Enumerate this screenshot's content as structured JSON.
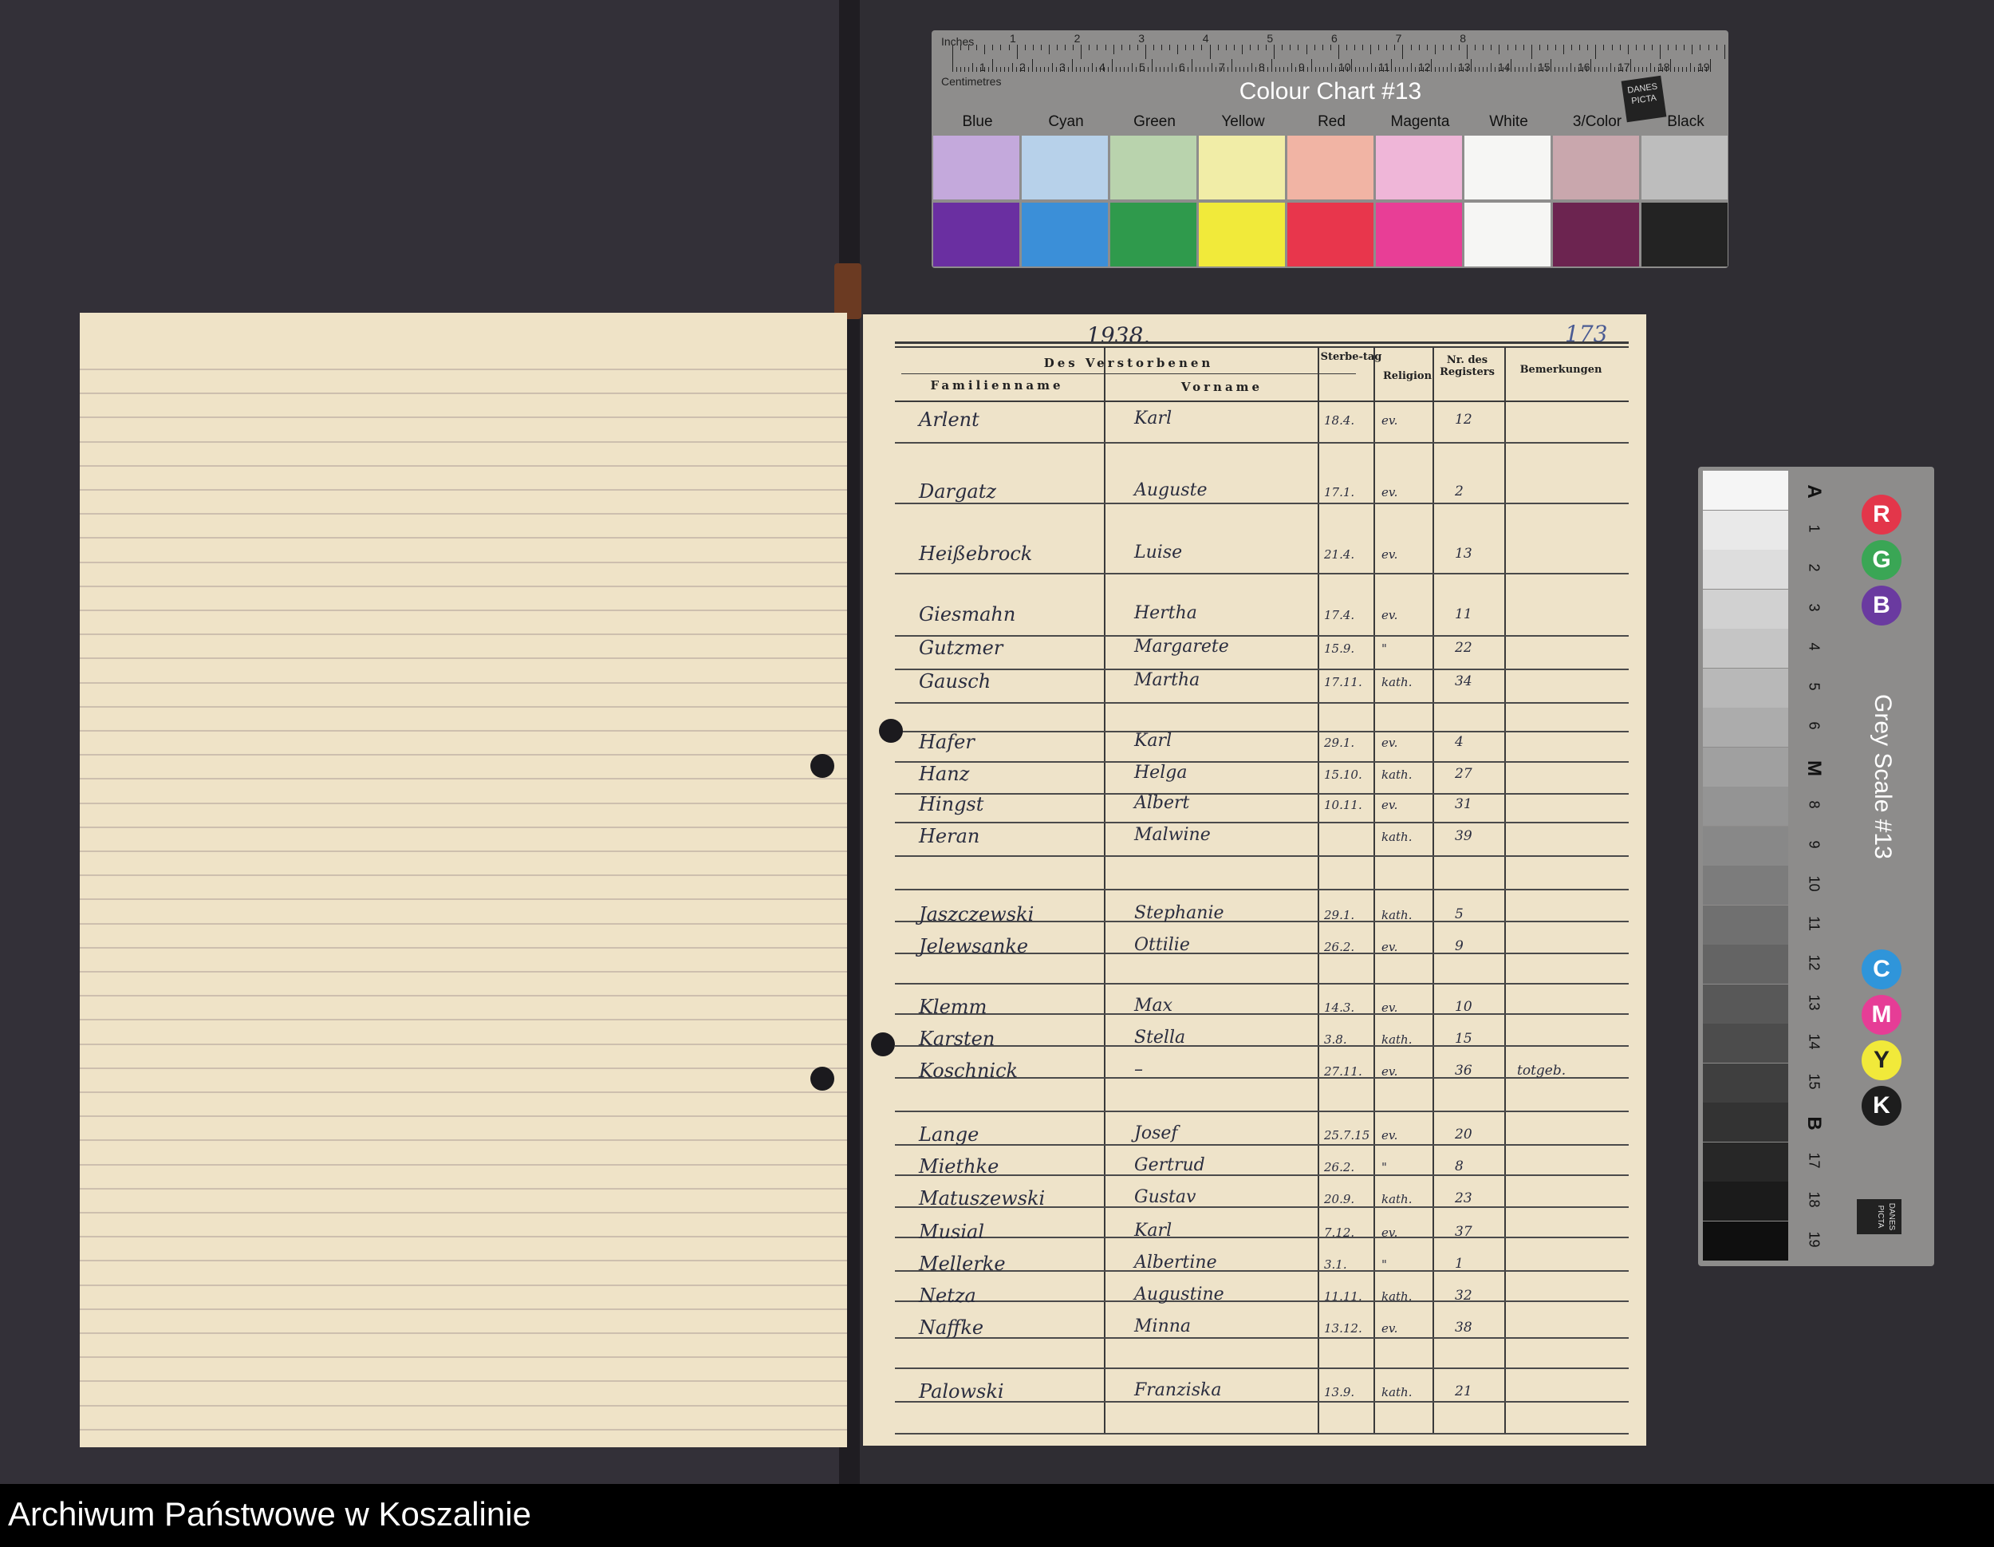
{
  "footer": {
    "archive_name": "Archiwum Państwowe w Koszalinie"
  },
  "colour_chart": {
    "ruler_inches_label": "Inches",
    "ruler_cm_label": "Centimetres",
    "inch_numbers": [
      "1",
      "2",
      "3",
      "4",
      "5",
      "6",
      "7",
      "8"
    ],
    "cm_numbers": [
      "1",
      "2",
      "3",
      "4",
      "5",
      "6",
      "7",
      "8",
      "9",
      "10",
      "11",
      "12",
      "13",
      "14",
      "15",
      "16",
      "17",
      "18",
      "19"
    ],
    "title": "Colour Chart #13",
    "brand": "DANES PICTA",
    "patches": [
      {
        "name": "Blue",
        "light": "#c4a9dc",
        "dark": "#6a2fa1"
      },
      {
        "name": "Cyan",
        "light": "#b7d1ea",
        "dark": "#3b8fd8"
      },
      {
        "name": "Green",
        "light": "#b9d3ad",
        "dark": "#2f9a4c"
      },
      {
        "name": "Yellow",
        "light": "#f1eda7",
        "dark": "#f1ea3a"
      },
      {
        "name": "Red",
        "light": "#f1b4a4",
        "dark": "#e8364c"
      },
      {
        "name": "Magenta",
        "light": "#efb6d8",
        "dark": "#e83e96"
      },
      {
        "name": "White",
        "light": "#f6f6f4",
        "dark": "#f6f6f4"
      },
      {
        "name": "3/Color",
        "light": "#c9a7ad",
        "dark": "#6c2450"
      },
      {
        "name": "Black",
        "light": "#bdbdbd",
        "dark": "#232323"
      }
    ]
  },
  "grey_scale": {
    "title": "Grey Scale #13",
    "brand": "DANES PICTA",
    "steps": [
      "A",
      "1",
      "2",
      "3",
      "4",
      "5",
      "6",
      "M",
      "8",
      "9",
      "10",
      "11",
      "12",
      "13",
      "14",
      "15",
      "B",
      "17",
      "18",
      "19"
    ],
    "rgb": [
      {
        "letter": "R",
        "color": "#e3364a"
      },
      {
        "letter": "G",
        "color": "#3aa655"
      },
      {
        "letter": "B",
        "color": "#6a3aa0"
      }
    ],
    "cmyk": [
      {
        "letter": "C",
        "color": "#2f95da"
      },
      {
        "letter": "M",
        "color": "#e63d96"
      },
      {
        "letter": "Y",
        "color": "#f1e93a"
      },
      {
        "letter": "K",
        "color": "#1d1d1d"
      }
    ]
  },
  "register": {
    "year": "1938.",
    "page_number": "173",
    "header": {
      "group": "Des Verstorbenen",
      "familienname": "Familienname",
      "vorname": "Vorname",
      "sterbetag": "Sterbe-tag",
      "religion": "Religion",
      "nr": "Nr. des Registers",
      "bemerkungen": "Bemerkungen"
    },
    "rows": [
      {
        "familienname": "Arlent",
        "vorname": "Karl",
        "sterbetag": "18.4.",
        "religion": "ev.",
        "nr": "12",
        "bemerkungen": ""
      },
      {
        "familienname": "Dargatz",
        "vorname": "Auguste",
        "sterbetag": "17.1.",
        "religion": "ev.",
        "nr": "2",
        "bemerkungen": ""
      },
      {
        "familienname": "Heißebrock",
        "vorname": "Luise",
        "sterbetag": "21.4.",
        "religion": "ev.",
        "nr": "13",
        "bemerkungen": ""
      },
      {
        "familienname": "Giesmahn",
        "vorname": "Hertha",
        "sterbetag": "17.4.",
        "religion": "ev.",
        "nr": "11",
        "bemerkungen": ""
      },
      {
        "familienname": "Gutzmer",
        "vorname": "Margarete",
        "sterbetag": "15.9.",
        "religion": "\"",
        "nr": "22",
        "bemerkungen": ""
      },
      {
        "familienname": "Gausch",
        "vorname": "Martha",
        "sterbetag": "17.11.",
        "religion": "kath.",
        "nr": "34",
        "bemerkungen": ""
      },
      {
        "familienname": "Hafer",
        "vorname": "Karl",
        "sterbetag": "29.1.",
        "religion": "ev.",
        "nr": "4",
        "bemerkungen": ""
      },
      {
        "familienname": "Hanz",
        "vorname": "Helga",
        "sterbetag": "15.10.",
        "religion": "kath.",
        "nr": "27",
        "bemerkungen": ""
      },
      {
        "familienname": "Hingst",
        "vorname": "Albert",
        "sterbetag": "10.11.",
        "religion": "ev.",
        "nr": "31",
        "bemerkungen": ""
      },
      {
        "familienname": "Heran",
        "vorname": "Malwine",
        "sterbetag": "",
        "religion": "kath.",
        "nr": "39",
        "bemerkungen": ""
      },
      {
        "familienname": "Jaszczewski",
        "vorname": "Stephanie",
        "sterbetag": "29.1.",
        "religion": "kath.",
        "nr": "5",
        "bemerkungen": ""
      },
      {
        "familienname": "Jelewsanke",
        "vorname": "Ottilie",
        "sterbetag": "26.2.",
        "religion": "ev.",
        "nr": "9",
        "bemerkungen": ""
      },
      {
        "familienname": "Klemm",
        "vorname": "Max",
        "sterbetag": "14.3.",
        "religion": "ev.",
        "nr": "10",
        "bemerkungen": ""
      },
      {
        "familienname": "Karsten",
        "vorname": "Stella",
        "sterbetag": "3.8.",
        "religion": "kath.",
        "nr": "15",
        "bemerkungen": ""
      },
      {
        "familienname": "Koschnick",
        "vorname": "–",
        "sterbetag": "27.11.",
        "religion": "ev.",
        "nr": "36",
        "bemerkungen": "totgeb."
      },
      {
        "familienname": "Lange",
        "vorname": "Josef",
        "sterbetag": "25.7.15",
        "religion": "ev.",
        "nr": "20",
        "bemerkungen": ""
      },
      {
        "familienname": "Miethke",
        "vorname": "Gertrud",
        "sterbetag": "26.2.",
        "religion": "\"",
        "nr": "8",
        "bemerkungen": ""
      },
      {
        "familienname": "Matuszewski",
        "vorname": "Gustav",
        "sterbetag": "20.9.",
        "religion": "kath.",
        "nr": "23",
        "bemerkungen": ""
      },
      {
        "familienname": "Musial",
        "vorname": "Karl",
        "sterbetag": "7.12.",
        "religion": "ev.",
        "nr": "37",
        "bemerkungen": ""
      },
      {
        "familienname": "Mellerke",
        "vorname": "Albertine",
        "sterbetag": "3.1.",
        "religion": "\"",
        "nr": "1",
        "bemerkungen": ""
      },
      {
        "familienname": "Netza",
        "vorname": "Augustine",
        "sterbetag": "11.11.",
        "religion": "kath.",
        "nr": "32",
        "bemerkungen": ""
      },
      {
        "familienname": "Naffke",
        "vorname": "Minna",
        "sterbetag": "13.12.",
        "religion": "ev.",
        "nr": "38",
        "bemerkungen": ""
      },
      {
        "familienname": "Palowski",
        "vorname": "Franziska",
        "sterbetag": "13.9.",
        "religion": "kath.",
        "nr": "21",
        "bemerkungen": ""
      }
    ]
  }
}
